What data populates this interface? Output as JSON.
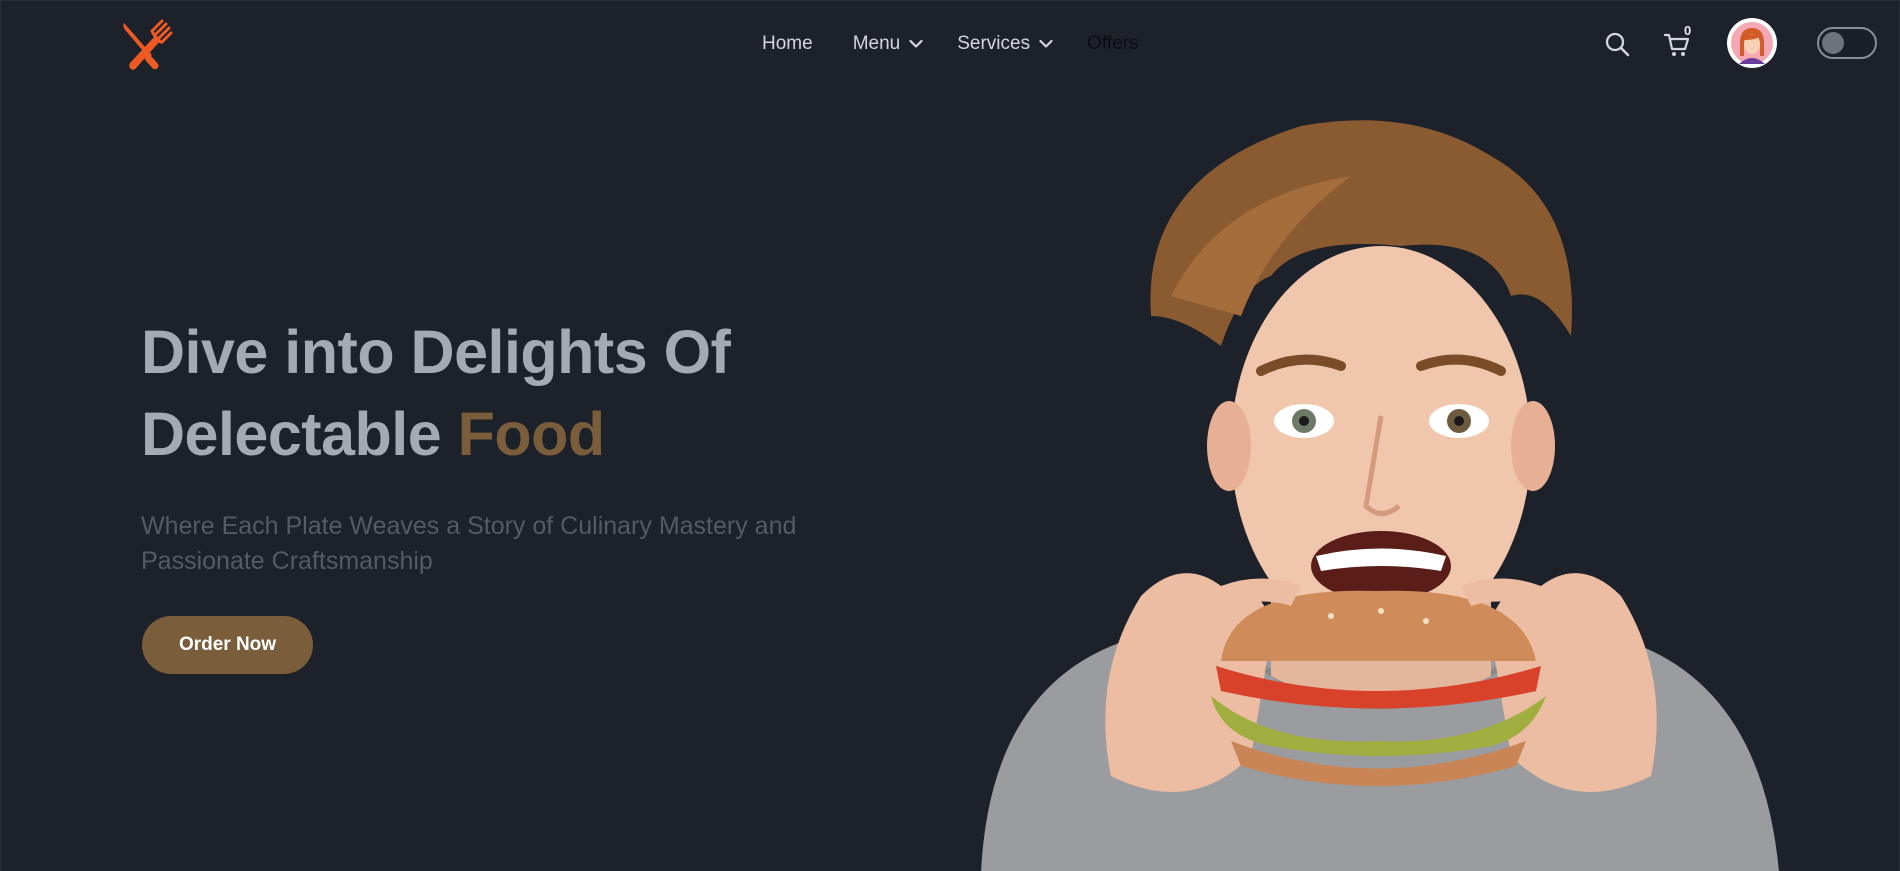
{
  "nav": {
    "links": [
      {
        "label": "Home"
      },
      {
        "label": "Menu"
      },
      {
        "label": "Services"
      },
      {
        "label": "Offers"
      }
    ],
    "cart_count": "0",
    "icons": {
      "logo": "fork-knife-logo-icon",
      "search": "search-icon",
      "cart": "cart-icon",
      "avatar": "user-avatar",
      "theme_toggle": "dark-mode-toggle"
    }
  },
  "hero": {
    "title_line1": "Dive into Delights Of",
    "title_line2_prefix": "Delectable ",
    "title_line2_accent": "Food",
    "subtitle": "Where Each Plate Weaves a Story of Culinary Mastery and Passionate Craftsmanship",
    "cta_label": "Order Now"
  },
  "colors": {
    "background": "#1d2129",
    "accent": "#7a5e3b",
    "logo": "#ee5a24",
    "title": "#a5a9b2",
    "subtitle": "#555a63"
  }
}
